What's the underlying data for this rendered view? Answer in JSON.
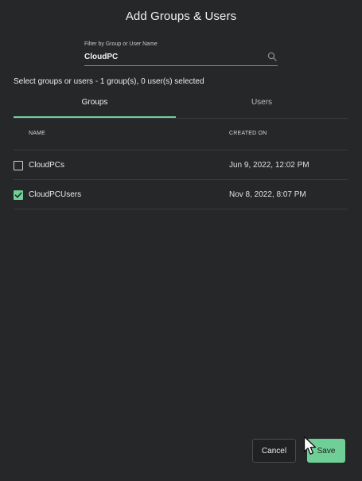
{
  "dialog": {
    "title": "Add Groups & Users"
  },
  "filter": {
    "label": "Filter by Group or User Name",
    "value": "CloudPC",
    "icon": "search-icon"
  },
  "selection_summary": "Select groups or users - 1 group(s), 0 user(s) selected",
  "tabs": [
    {
      "label": "Groups",
      "active": true
    },
    {
      "label": "Users",
      "active": false
    }
  ],
  "table": {
    "columns": [
      "NAME",
      "CREATED ON"
    ],
    "rows": [
      {
        "name": "CloudPCs",
        "created_on": "Jun 9, 2022, 12:02 PM",
        "checked": false
      },
      {
        "name": "CloudPCUsers",
        "created_on": "Nov 8, 2022, 8:07 PM",
        "checked": true
      }
    ]
  },
  "footer": {
    "cancel_label": "Cancel",
    "save_label": "Save"
  },
  "colors": {
    "accent": "#6fcf97",
    "background": "#262729"
  }
}
